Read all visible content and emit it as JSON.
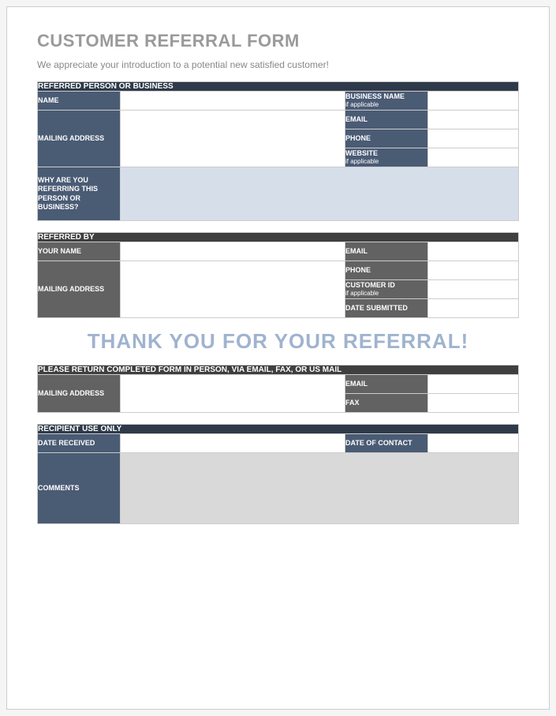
{
  "header": {
    "title": "CUSTOMER REFERRAL FORM",
    "subtitle": "We appreciate your introduction to a potential new satisfied customer!"
  },
  "section1": {
    "header": "REFERRED PERSON OR BUSINESS",
    "name": "NAME",
    "business_name": "BUSINESS NAME",
    "if_applicable": "if applicable",
    "mailing_address": "MAILING ADDRESS",
    "email": "EMAIL",
    "phone": "PHONE",
    "website": "WEBSITE",
    "reason": "WHY ARE YOU REFERRING THIS PERSON OR BUSINESS?"
  },
  "section2": {
    "header": "REFERRED BY",
    "your_name": "YOUR NAME",
    "email": "EMAIL",
    "mailing_address": "MAILING ADDRESS",
    "phone": "PHONE",
    "customer_id": "CUSTOMER ID",
    "if_applicable": "if applicable",
    "date_submitted": "DATE SUBMITTED"
  },
  "thanks": "THANK YOU FOR YOUR REFERRAL!",
  "section3": {
    "header": "PLEASE RETURN COMPLETED FORM IN PERSON, VIA EMAIL, FAX, OR US MAIL",
    "mailing_address": "MAILING ADDRESS",
    "email": "EMAIL",
    "fax": "FAX"
  },
  "section4": {
    "header": "RECIPIENT USE ONLY",
    "date_received": "DATE RECEIVED",
    "date_of_contact": "DATE OF CONTACT",
    "comments": "COMMENTS"
  }
}
